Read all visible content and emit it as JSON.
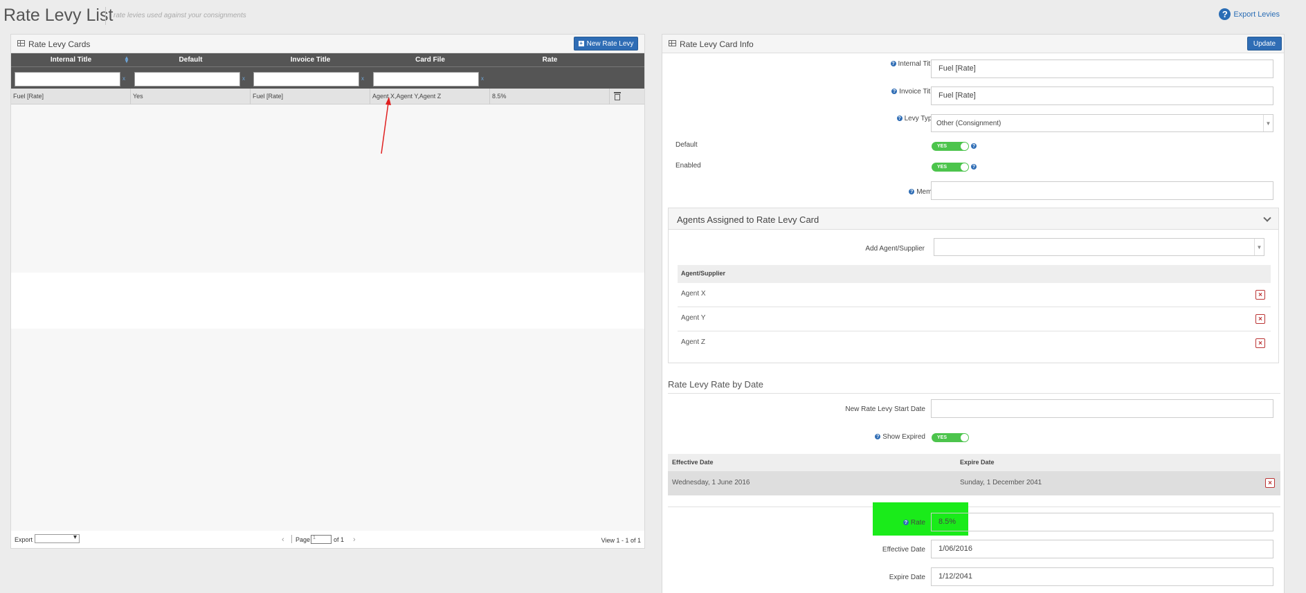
{
  "header": {
    "title": "Rate Levy List",
    "subtitle": "rate levies used against your consignments",
    "export_levies": "Export Levies"
  },
  "left_panel": {
    "title": "Rate Levy Cards",
    "new_button": "New Rate Levy",
    "columns": [
      "Internal Title",
      "Default",
      "Invoice Title",
      "Card File",
      "Rate"
    ],
    "rows": [
      {
        "internal_title": "Fuel [Rate]",
        "default": "Yes",
        "invoice_title": "Fuel [Rate]",
        "card_file": "Agent X,Agent Y,Agent Z",
        "rate": "8.5%"
      }
    ],
    "footer": {
      "export_label": "Export",
      "page_label": "Page",
      "page_value": "1",
      "of_label": "of 1",
      "view_info": "View 1 - 1 of 1"
    }
  },
  "right_panel": {
    "title": "Rate Levy Card Info",
    "update_button": "Update",
    "fields": {
      "internal_title_label": "Internal Title",
      "internal_title_value": "Fuel [Rate]",
      "invoice_title_label": "Invoice Title",
      "invoice_title_value": "Fuel [Rate]",
      "levy_type_label": "Levy Type",
      "levy_type_value": "Other (Consignment)",
      "default_label": "Default",
      "default_toggle": "YES",
      "enabled_label": "Enabled",
      "enabled_toggle": "YES",
      "memo_label": "Memo",
      "memo_value": ""
    },
    "agents": {
      "title": "Agents Assigned to Rate Levy Card",
      "add_label": "Add Agent/Supplier",
      "column": "Agent/Supplier",
      "list": [
        "Agent X",
        "Agent Y",
        "Agent Z"
      ]
    },
    "rate_by_date": {
      "title": "Rate Levy Rate by Date",
      "new_start_label": "New Rate Levy Start Date",
      "show_expired_label": "Show Expired",
      "show_expired_toggle": "YES",
      "columns": [
        "Effective Date",
        "Expire Date"
      ],
      "rows": [
        {
          "effective": "Wednesday, 1 June 2016",
          "expire": "Sunday, 1 December 2041"
        }
      ],
      "rate_label": "Rate",
      "rate_value": "8.5%",
      "effective_label": "Effective Date",
      "effective_value": "1/06/2016",
      "expire_label": "Expire Date",
      "expire_value": "1/12/2041"
    }
  },
  "colors": {
    "accent": "#2f6db5",
    "toggle_on": "#4cc44c",
    "highlight": "#1aeb1a",
    "delete": "#bb3333"
  }
}
